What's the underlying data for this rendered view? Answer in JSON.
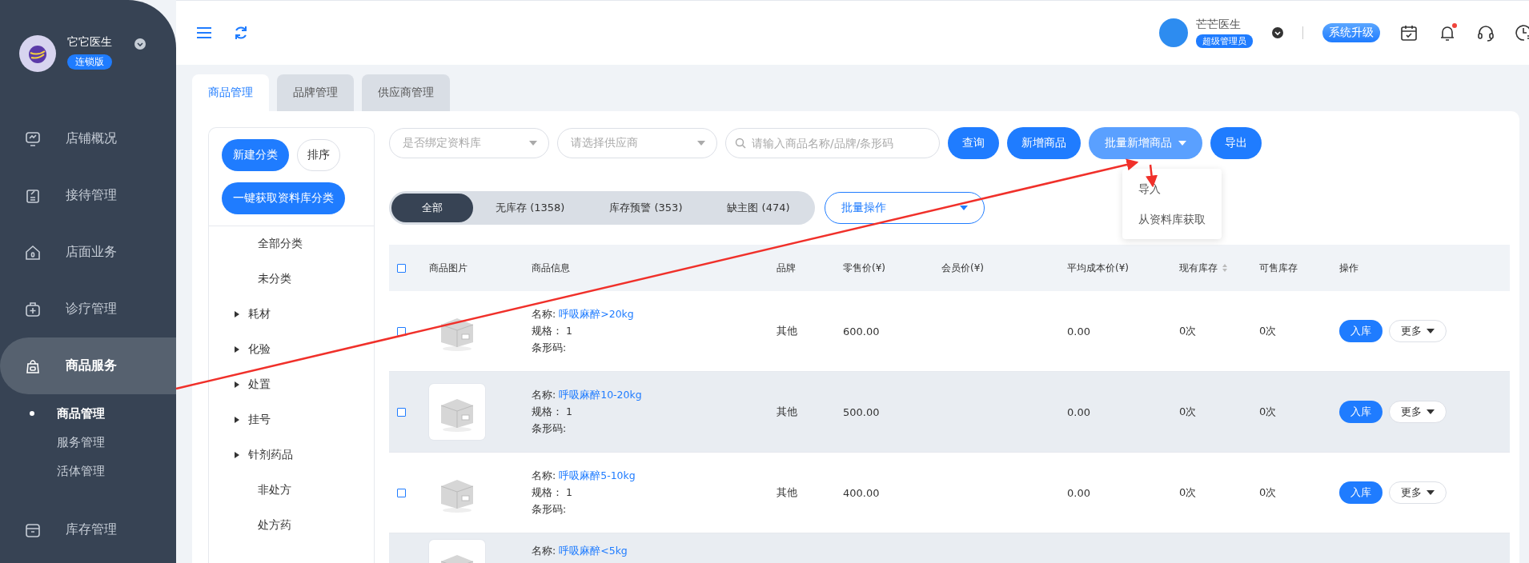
{
  "sidebar": {
    "user": {
      "name": "它它医生",
      "badge": "连锁版"
    },
    "nav": [
      {
        "label": "店铺概况",
        "selected": false
      },
      {
        "label": "接待管理",
        "selected": false
      },
      {
        "label": "店面业务",
        "selected": false
      },
      {
        "label": "诊疗管理",
        "selected": false
      },
      {
        "label": "商品服务",
        "selected": true,
        "children": [
          {
            "label": "商品管理",
            "selected": true
          },
          {
            "label": "服务管理",
            "selected": false
          },
          {
            "label": "活体管理",
            "selected": false
          }
        ]
      },
      {
        "label": "库存管理",
        "selected": false
      }
    ]
  },
  "topbar": {
    "user": {
      "name": "芒芒医生",
      "role": "超级管理员"
    },
    "upgrade": "系统升级",
    "notification_dot": true
  },
  "tabs": [
    {
      "label": "商品管理",
      "selected": true
    },
    {
      "label": "品牌管理",
      "selected": false
    },
    {
      "label": "供应商管理",
      "selected": false
    }
  ],
  "categories": {
    "buttons": [
      {
        "label": "新建分类",
        "kind": "primary"
      },
      {
        "label": "排序",
        "kind": "plain"
      },
      {
        "label": "一键获取资料库分类",
        "kind": "primary"
      }
    ],
    "items": [
      {
        "label": "全部分类",
        "kind": "leaf"
      },
      {
        "label": "未分类",
        "kind": "leaf"
      },
      {
        "label": "耗材",
        "kind": "group"
      },
      {
        "label": "化验",
        "kind": "group"
      },
      {
        "label": "处置",
        "kind": "group"
      },
      {
        "label": "挂号",
        "kind": "group"
      },
      {
        "label": "针剂药品",
        "kind": "group"
      },
      {
        "label": "非处方",
        "kind": "leaf"
      },
      {
        "label": "处方药",
        "kind": "leaf"
      }
    ]
  },
  "filters": {
    "selects": [
      {
        "placeholder": "是否绑定资料库"
      },
      {
        "placeholder": "请选择供应商"
      }
    ],
    "search": {
      "placeholder": "请输入商品名称/品牌/条形码"
    },
    "buttons": [
      {
        "label": "查询",
        "kind": "primary"
      },
      {
        "label": "新增商品",
        "kind": "primary"
      },
      {
        "label": "批量新增商品",
        "kind": "dropdown"
      },
      {
        "label": "导出",
        "kind": "primary"
      }
    ]
  },
  "dropdown_menu": [
    "导入",
    "从资料库获取"
  ],
  "segments": [
    {
      "label": "全部",
      "selected": true
    },
    {
      "label": "无库存 (1358)",
      "selected": false
    },
    {
      "label": "库存预警 (353)",
      "selected": false
    },
    {
      "label": "缺主图 (474)",
      "selected": false
    }
  ],
  "batch_select": {
    "placeholder": "批量操作"
  },
  "table": {
    "all_checked": false,
    "columns": [
      {
        "label": "商品图片",
        "sortable": false
      },
      {
        "label": "商品信息",
        "sortable": false
      },
      {
        "label": "品牌",
        "sortable": false
      },
      {
        "label": "零售价(¥)",
        "sortable": false
      },
      {
        "label": "会员价(¥)",
        "sortable": false
      },
      {
        "label": "平均成本价(¥)",
        "sortable": false
      },
      {
        "label": "现有库存",
        "sortable": true
      },
      {
        "label": "可售库存",
        "sortable": false
      },
      {
        "label": "操作",
        "sortable": false
      }
    ],
    "rows": [
      {
        "checked": false,
        "hovered": false,
        "name_label": "名称:",
        "name": "呼吸麻醉>20kg",
        "spec_label": "规格：",
        "spec": "1",
        "barcode_label": "条形码:",
        "brand": "其他",
        "retail": "600.00",
        "cost": "0.00",
        "stock": "0次",
        "sellable": "0次",
        "stock_in": "入库",
        "more": "更多"
      },
      {
        "checked": false,
        "hovered": true,
        "name_label": "名称:",
        "name": "呼吸麻醉10-20kg",
        "spec_label": "规格：",
        "spec": "1",
        "barcode_label": "条形码:",
        "brand": "其他",
        "retail": "500.00",
        "cost": "0.00",
        "stock": "0次",
        "sellable": "0次",
        "stock_in": "入库",
        "more": "更多"
      },
      {
        "checked": false,
        "hovered": false,
        "name_label": "名称:",
        "name": "呼吸麻醉5-10kg",
        "spec_label": "规格：",
        "spec": "1",
        "barcode_label": "条形码:",
        "brand": "其他",
        "retail": "400.00",
        "cost": "0.00",
        "stock": "0次",
        "sellable": "0次",
        "stock_in": "入库",
        "more": "更多"
      },
      {
        "hovered": true,
        "name_label": "名称:",
        "name": "呼吸麻醉<5kg"
      }
    ]
  }
}
